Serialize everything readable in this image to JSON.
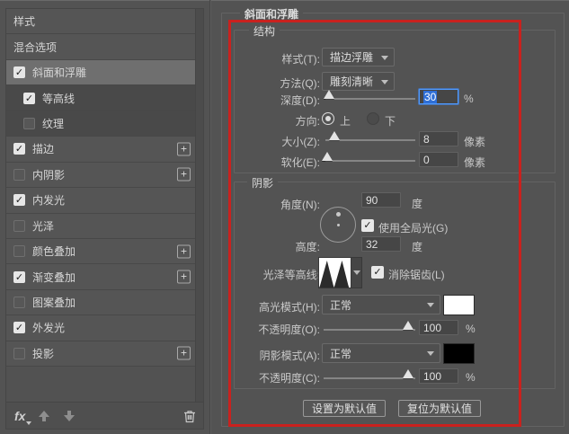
{
  "colors": {
    "annotation_red": "#c9211e",
    "selection_blue": "#2f6fd6"
  },
  "sidebar": {
    "items": [
      {
        "label": "样式",
        "type": "plain"
      },
      {
        "label": "混合选项",
        "type": "plain"
      },
      {
        "label": "斜面和浮雕",
        "checked": true,
        "selected": true
      },
      {
        "label": "等高线",
        "checked": true,
        "child": true
      },
      {
        "label": "纹理",
        "checked": false,
        "child": true
      },
      {
        "label": "描边",
        "checked": true,
        "plus": true
      },
      {
        "label": "内阴影",
        "checked": false,
        "plus": true
      },
      {
        "label": "内发光",
        "checked": true
      },
      {
        "label": "光泽",
        "checked": false
      },
      {
        "label": "颜色叠加",
        "checked": false,
        "plus": true
      },
      {
        "label": "渐变叠加",
        "checked": true,
        "plus": true
      },
      {
        "label": "图案叠加",
        "checked": false
      },
      {
        "label": "外发光",
        "checked": true
      },
      {
        "label": "投影",
        "checked": false,
        "plus": true
      }
    ],
    "footer": {
      "fx_label": "fx"
    }
  },
  "panel": {
    "title": "斜面和浮雕",
    "structure": {
      "legend": "结构",
      "style_label": "样式(T):",
      "style_value": "描边浮雕",
      "technique_label": "方法(Q):",
      "technique_value": "雕刻清晰",
      "depth_label": "深度(D):",
      "depth_value": "30",
      "depth_unit": "%",
      "direction_label": "方向:",
      "direction_up": "上",
      "direction_down": "下",
      "size_label": "大小(Z):",
      "size_value": "8",
      "size_unit": "像素",
      "soften_label": "软化(E):",
      "soften_value": "0",
      "soften_unit": "像素"
    },
    "shading": {
      "legend": "阴影",
      "angle_label": "角度(N):",
      "angle_value": "90",
      "angle_unit": "度",
      "global_light_check": "✓",
      "global_light_label": "使用全局光(G)",
      "altitude_label": "高度:",
      "altitude_value": "32",
      "altitude_unit": "度",
      "gloss_contour_label": "光泽等高线:",
      "anti_alias_check": "✓",
      "anti_alias_label": "消除锯齿(L)",
      "highlight_mode_label": "高光模式(H):",
      "highlight_mode_value": "正常",
      "highlight_color": "#ffffff",
      "highlight_opacity_label": "不透明度(O):",
      "highlight_opacity_value": "100",
      "highlight_opacity_unit": "%",
      "shadow_mode_label": "阴影模式(A):",
      "shadow_mode_value": "正常",
      "shadow_color": "#000000",
      "shadow_opacity_label": "不透明度(C):",
      "shadow_opacity_value": "100",
      "shadow_opacity_unit": "%"
    },
    "buttons": {
      "make_default": "设置为默认值",
      "reset_default": "复位为默认值"
    }
  }
}
